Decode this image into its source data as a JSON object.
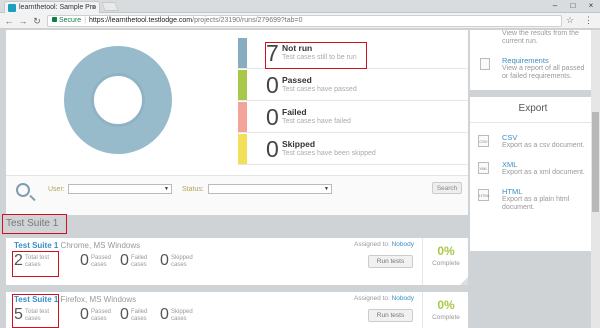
{
  "browser": {
    "tab_title": "learnthetool: Sample Pro",
    "secure_label": "Secure",
    "url_host": "https://learnthetool.testlodge.com",
    "url_path": "/projects/23190/runs/279699?tab=0"
  },
  "stats": [
    {
      "count": "7",
      "label": "Not run",
      "sub": "Test cases still to be run",
      "color": "#87aec0"
    },
    {
      "count": "0",
      "label": "Passed",
      "sub": "Test cases have passed",
      "color": "#a8c84a"
    },
    {
      "count": "0",
      "label": "Failed",
      "sub": "Test cases have failed",
      "color": "#f2a39a"
    },
    {
      "count": "0",
      "label": "Skipped",
      "sub": "Test cases have been skipped",
      "color": "#f4df5a"
    }
  ],
  "right_panel": {
    "view_desc": "View the results from the current run.",
    "requirements_label": "Requirements",
    "requirements_desc": "View a report of all passed or failed requirements."
  },
  "export": {
    "title": "Export",
    "items": [
      {
        "icon": "CSV",
        "label": "CSV",
        "desc": "Export as a csv document."
      },
      {
        "icon": "XML",
        "label": "XML",
        "desc": "Export as a xml document."
      },
      {
        "icon": "HTML",
        "label": "HTML",
        "desc": "Export as a plain html document."
      }
    ]
  },
  "filter": {
    "user_label": "User:",
    "status_label": "Status:",
    "search_button": "Search"
  },
  "suite_header": "Test Suite 1",
  "runs": [
    {
      "name": "Test Suite 1",
      "env": "Chrome, MS Windows",
      "total": "2",
      "total_label": "Total test cases",
      "passed": "0",
      "passed_label": "Passed cases",
      "failed": "0",
      "failed_label": "Failed cases",
      "skipped": "0",
      "skipped_label": "Skipped cases",
      "assigned_label": "Assigned to:",
      "assignee": "Nobody",
      "run_button": "Run tests",
      "progress": "0%",
      "progress_label": "Complete"
    },
    {
      "name": "Test Suite 1",
      "env": "Firefox, MS Windows",
      "total": "5",
      "total_label": "Total test cases",
      "passed": "0",
      "passed_label": "Passed cases",
      "failed": "0",
      "failed_label": "Failed cases",
      "skipped": "0",
      "skipped_label": "Skipped cases",
      "assigned_label": "Assigned to:",
      "assignee": "Nobody",
      "run_button": "Run tests",
      "progress": "0%",
      "progress_label": "Complete"
    }
  ]
}
